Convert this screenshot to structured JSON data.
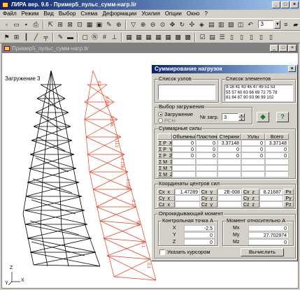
{
  "app": {
    "title": "ЛИРА  вер. 9.6 - Пример5_пульс_сумм-нагр.lir",
    "menu": [
      "Файл",
      "Режим",
      "Вид",
      "Выбор",
      "Схема",
      "Деформации",
      "Усилия",
      "Опции",
      "Окно",
      "?"
    ],
    "toolbar_value": "3"
  },
  "document": {
    "title": "Пример5_пульс_сумм-нагр.lir",
    "load_label": "Загружение 3",
    "axes": {
      "x": "X",
      "y": "Y",
      "z": "Z"
    },
    "member_labels": [
      "0.1",
      "0.095",
      "0.146",
      "0.113",
      "0.106",
      "0.098",
      "0.1",
      "0.1",
      "0.1",
      "0.1"
    ]
  },
  "dialog": {
    "title": "Суммирование нагрузок",
    "nodes_group": "Список узлов",
    "elements_group": "Список элементов",
    "elements_list": [
      "9-16 41 43 45 47 49 51 53",
      "55 57 60 63 66 69 72 75 78",
      "81 84 87 90 93 96 99 102"
    ],
    "load_group": "Выбор загружения",
    "radio_load": "Загружение",
    "radio_rsn": "РСН",
    "load_no_label": "№ загр.",
    "load_no_value": "3",
    "forces_group": "Суммарные силы",
    "forces_headers": [
      "Объемные",
      "Пластины",
      "Стержни",
      "Узлы",
      "Всего"
    ],
    "forces_rows": [
      {
        "label": "Σ P_X",
        "values": [
          "0",
          "0",
          "3.37148",
          "0",
          "3.37148"
        ]
      },
      {
        "label": "Σ P_Y",
        "values": [
          "0",
          "0",
          "0",
          "0",
          "0"
        ]
      },
      {
        "label": "Σ P_Z",
        "values": [
          "0",
          "0",
          "0",
          "0",
          "0"
        ]
      },
      {
        "label": "Σ M_X",
        "values": [
          "",
          "",
          "",
          "",
          ""
        ]
      },
      {
        "label": "Σ M_Y",
        "values": [
          "",
          "",
          "",
          "",
          ""
        ]
      },
      {
        "label": "Σ M_Z",
        "values": [
          "",
          "",
          "",
          "",
          ""
        ]
      }
    ],
    "centers_group": "Координаты центров сил",
    "centers": {
      "r1": [
        "Cx_x",
        "1.47289",
        "Cx_y",
        "2E-008",
        "Cx_z",
        "8.21687",
        "Px"
      ],
      "r2": [
        "Cy_x",
        "",
        "Cy_y",
        "",
        "Cy_z",
        "",
        "Py"
      ],
      "r3": [
        "Cz_x",
        "",
        "Cz_y",
        "",
        "Cz_z",
        "",
        "Pz"
      ]
    },
    "moment_group": "Опрокидывающий момент",
    "point_group": "Контрольная точка А",
    "point": [
      {
        "label": "X",
        "value": "-2.5"
      },
      {
        "label": "Y",
        "value": "0"
      },
      {
        "label": "Z",
        "value": "0"
      }
    ],
    "moment_rel_group": "Момент относительно А",
    "moments": [
      {
        "label": "Mx",
        "value": "0"
      },
      {
        "label": "My",
        "value": "27.702974"
      },
      {
        "label": "Mz",
        "value": "0"
      }
    ],
    "cursor_checkbox": "Указать курсором",
    "calc_button": "Вычислить"
  }
}
